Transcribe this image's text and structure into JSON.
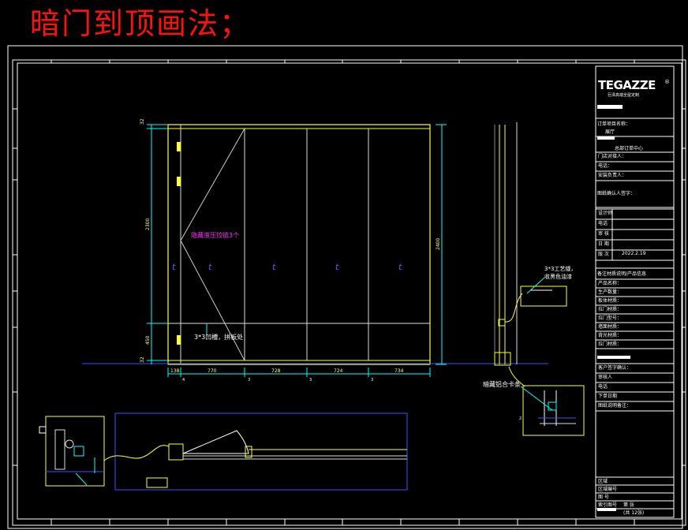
{
  "title": "暗门到顶画法；",
  "brand": {
    "name": "TEGAZZE",
    "tagline": "巨泽高端全屋定制",
    "registered": "®"
  },
  "annotations": {
    "hinge_note": "隐藏液压铰链3个",
    "groove_note_bottom": "3*3凹槽，拼板处",
    "groove_note_side": "3*3工艺缝，",
    "groove_note_side2": "收黑色油漆",
    "clip_note": "暗藏铝合卡条"
  },
  "dimensions": {
    "left_top": "32",
    "left_main": "2300",
    "left_lower": "450",
    "left_bottom": "32",
    "right_height": "2400",
    "bottom": [
      "138",
      "770",
      "728",
      "724",
      "734"
    ]
  },
  "section_marks": [
    "4",
    "3",
    "3",
    "3",
    "2"
  ],
  "title_block": {
    "project_label": "订单项目名称：",
    "project_value": "展厅",
    "center_label": "总部订单中心",
    "rows_a": [
      "门店对接人：",
      "电话：",
      "安装负责人："
    ],
    "sign_label": "图纸确认人签字：",
    "rows_b": [
      "设计师",
      "电话",
      "审 核",
      "日 期",
      "版 次"
    ],
    "date_value": "2022.2.19",
    "note_label": "备注材质说明/产品信息",
    "rows_c": [
      "产品名称：",
      "生产数量：",
      "板体材质：",
      "拉门材质：",
      "拉门型号：",
      "墙面材质：",
      "背光材质：",
      "拉门材质："
    ],
    "rows_d": [
      "客户签字确认：",
      "审核人",
      "电话",
      "下单日期",
      "图纸说明备注："
    ],
    "rows_e": [
      "区域",
      "区域编号",
      "图 号",
      "索引图号"
    ],
    "sheet_label": "第 张",
    "sheet_total": "(共 12张)"
  },
  "colors": {
    "frame": "#ffffff",
    "door": "#ffff33",
    "dimension": "#00ffff",
    "section": "#3333ff",
    "hinge_text": "#ff33ff",
    "title": "#ff1010",
    "detail": "#eeee88"
  }
}
